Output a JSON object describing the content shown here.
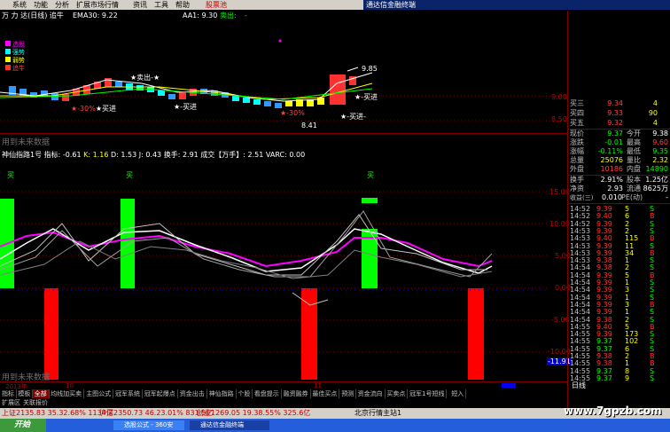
{
  "menu": {
    "items": [
      "系统",
      "功能",
      "分析",
      "扩展市场行情",
      "资讯",
      "工具",
      "帮助"
    ],
    "badge": "股票池",
    "app_title": "通达信金融终端"
  },
  "main_chart": {
    "header": {
      "title": "万 力 达(日线) 追牛",
      "ema": "EMA30: 9.22",
      "aa": "AA1: 9.30",
      "sell_label": "卖出:",
      "sell_value": "-"
    },
    "legend": [
      "选股",
      "强势",
      "弱势",
      "追牛"
    ],
    "price_labels": {
      "hi": "9.85",
      "lo": "8.41",
      "mark1": "-30%"
    },
    "annotations": {
      "sell": "卖出",
      "buy1": "买进",
      "buy2": "买进",
      "buy3": "买进",
      "buy4": "买进",
      "buy5": "买进"
    },
    "yticks_right": [
      "9.00",
      "8.50"
    ],
    "watermark_top": "用到未来数据"
  },
  "indicator": {
    "header": "神仙指路1号 指标: -0.61  K: 1.16  D: 1.53  J: 0.43  换手: 2.91  成交【万手】: 2.51   VARC: 0.00",
    "header_parts": {
      "name": "神仙指路1号 指标:",
      "idx": "-0.61",
      "k": "K: 1.16",
      "d": "D: 1.53",
      "j": "J: 0.43",
      "turnover": "换手: 2.91",
      "vol": "成交【万手】: 2.51",
      "varc": "VARC: 0.00"
    },
    "buy_label": "买",
    "yticks": [
      "15.00",
      "10.00",
      "5.00",
      "0.00",
      "-5.00",
      "-10.00"
    ],
    "ybottom": "-11.91",
    "watermark": "用到未来数据",
    "xlabels": [
      "2013年",
      "10",
      "11"
    ]
  },
  "quote": {
    "rows": [
      {
        "k": "买三",
        "v": "9.34",
        "v2": "4"
      },
      {
        "k": "买四",
        "v": "9.33",
        "v2": "90"
      },
      {
        "k": "买五",
        "v": "9.32",
        "v2": "4"
      }
    ],
    "stats": [
      {
        "k": "现价",
        "v": "9.37",
        "k2": "今开",
        "v2": "9.38"
      },
      {
        "k": "涨跌",
        "v": "-0.01",
        "k2": "最高",
        "v2": "9.60"
      },
      {
        "k": "涨幅",
        "v": "-0.11%",
        "k2": "最低",
        "v2": "9.35"
      },
      {
        "k": "总量",
        "v": "25076",
        "k2": "量比",
        "v2": "2.32"
      },
      {
        "k": "外盘",
        "v": "10186",
        "k2": "内盘",
        "v2": "14890"
      },
      {
        "k": "换手",
        "v": "2.91%",
        "k2": "股本",
        "v2": "1.25亿"
      },
      {
        "k": "净资",
        "v": "2.93",
        "k2": "流通",
        "v2": "8625万"
      },
      {
        "k": "收益(三)",
        "v": "0.010",
        "k2": "PE(动)",
        "v2": "-"
      }
    ],
    "ticks": [
      {
        "t": "14:52",
        "p": "9.39",
        "n": "5",
        "s": "S"
      },
      {
        "t": "14:52",
        "p": "9.40",
        "n": "6",
        "s": "B"
      },
      {
        "t": "14:52",
        "p": "9.39",
        "n": "2",
        "s": "S"
      },
      {
        "t": "14:53",
        "p": "9.39",
        "n": "2",
        "s": "S"
      },
      {
        "t": "14:53",
        "p": "9.40",
        "n": "115",
        "s": "B"
      },
      {
        "t": "14:53",
        "p": "9.39",
        "n": "11",
        "s": "S"
      },
      {
        "t": "14:53",
        "p": "9.39",
        "n": "34",
        "s": "B"
      },
      {
        "t": "14:53",
        "p": "9.38",
        "n": "1",
        "s": "S"
      },
      {
        "t": "14:54",
        "p": "9.38",
        "n": "2",
        "s": "S"
      },
      {
        "t": "14:54",
        "p": "9.39",
        "n": "5",
        "s": "B"
      },
      {
        "t": "14:54",
        "p": "9.39",
        "n": "1",
        "s": "S"
      },
      {
        "t": "14:54",
        "p": "9.39",
        "n": "3",
        "s": "S"
      },
      {
        "t": "14:54",
        "p": "9.39",
        "n": "1",
        "s": "S"
      },
      {
        "t": "14:54",
        "p": "9.39",
        "n": "3",
        "s": "B"
      },
      {
        "t": "14:54",
        "p": "9.39",
        "n": "1",
        "s": "S"
      },
      {
        "t": "14:54",
        "p": "9.38",
        "n": "2",
        "s": "S"
      },
      {
        "t": "14:55",
        "p": "9.40",
        "n": "5",
        "s": "B"
      },
      {
        "t": "14:55",
        "p": "9.39",
        "n": "173",
        "s": "S"
      },
      {
        "t": "14:55",
        "p": "9.37",
        "n": "102",
        "s": "S"
      },
      {
        "t": "14:55",
        "p": "9.37",
        "n": "6",
        "s": "S"
      },
      {
        "t": "14:55",
        "p": "9.38",
        "n": "2",
        "s": "B"
      },
      {
        "t": "14:55",
        "p": "9.38",
        "n": "1",
        "s": "B"
      },
      {
        "t": "14:55",
        "p": "9.37",
        "n": "8",
        "s": "S"
      },
      {
        "t": "14:55",
        "p": "9.37",
        "n": "9",
        "s": "S"
      }
    ],
    "footer": "日线"
  },
  "tabs": [
    "指标",
    "模板",
    "全部",
    "均线加买卖",
    "主图公式",
    "冠军系统",
    "冠军起爆点",
    "资金出击",
    "神仙指路",
    "个股",
    "看盘提示",
    "融资融券",
    "最佳买点",
    "预测",
    "资金流向",
    "买卖点",
    "冠军1号短线",
    "短入"
  ],
  "tabs2": [
    "扩展区",
    "关联报价"
  ],
  "status": {
    "sh": "上证2135.83  35.32.68%  1134亿",
    "sz": "沪深2350.73  46.23.01%  831.5亿",
    "cy": "创业1269.05  19.38.55%  325.6亿",
    "news": "北京行情主站1"
  },
  "taskbar": {
    "start": "开始",
    "items": [
      "选股公式 - 360安",
      "通达信金融终端"
    ],
    "watermark": "www.7gpzb.com"
  },
  "colors": {
    "up": "#ff3232",
    "down": "#00ff00",
    "bg": "#000000",
    "grid": "#800000"
  }
}
